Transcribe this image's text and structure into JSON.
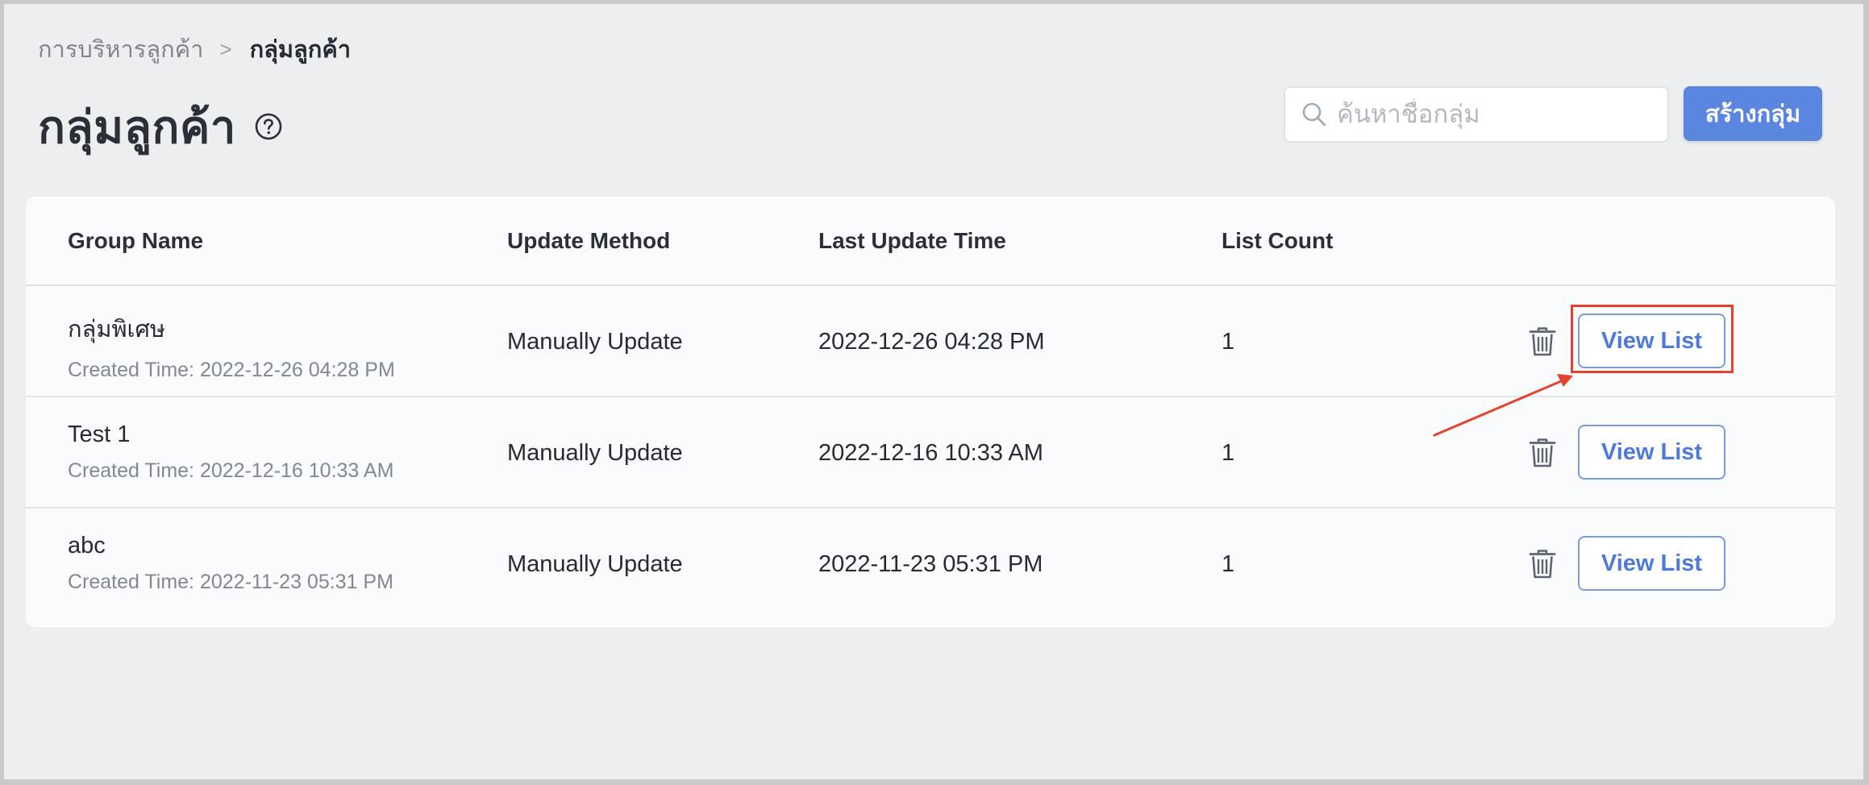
{
  "breadcrumb": {
    "parent": "การบริหารลูกค้า",
    "separator": ">",
    "current": "กลุ่มลูกค้า"
  },
  "header": {
    "title": "กลุ่มลูกค้า",
    "help_icon": "question-circle-icon"
  },
  "search": {
    "placeholder": "ค้นหาชื่อกลุ่ม",
    "value": "",
    "icon": "search-icon"
  },
  "create_button_label": "สร้างกลุ่ม",
  "table": {
    "columns": [
      "Group Name",
      "Update Method",
      "Last Update Time",
      "List Count"
    ],
    "rows": [
      {
        "name": "กลุ่มพิเศษ",
        "created": "Created Time: 2022-12-26 04:28 PM",
        "method": "Manually Update",
        "last_update": "2022-12-26 04:28 PM",
        "count": "1",
        "action_label": "View List"
      },
      {
        "name": "Test 1",
        "created": "Created Time: 2022-12-16 10:33 AM",
        "method": "Manually Update",
        "last_update": "2022-12-16 10:33 AM",
        "count": "1",
        "action_label": "View List"
      },
      {
        "name": "abc",
        "created": "Created Time: 2022-11-23 05:31 PM",
        "method": "Manually Update",
        "last_update": "2022-11-23 05:31 PM",
        "count": "1",
        "action_label": "View List"
      }
    ]
  },
  "colors": {
    "primary": "#5b86e0",
    "annotation": "#e2432e",
    "background": "#edeef0"
  }
}
